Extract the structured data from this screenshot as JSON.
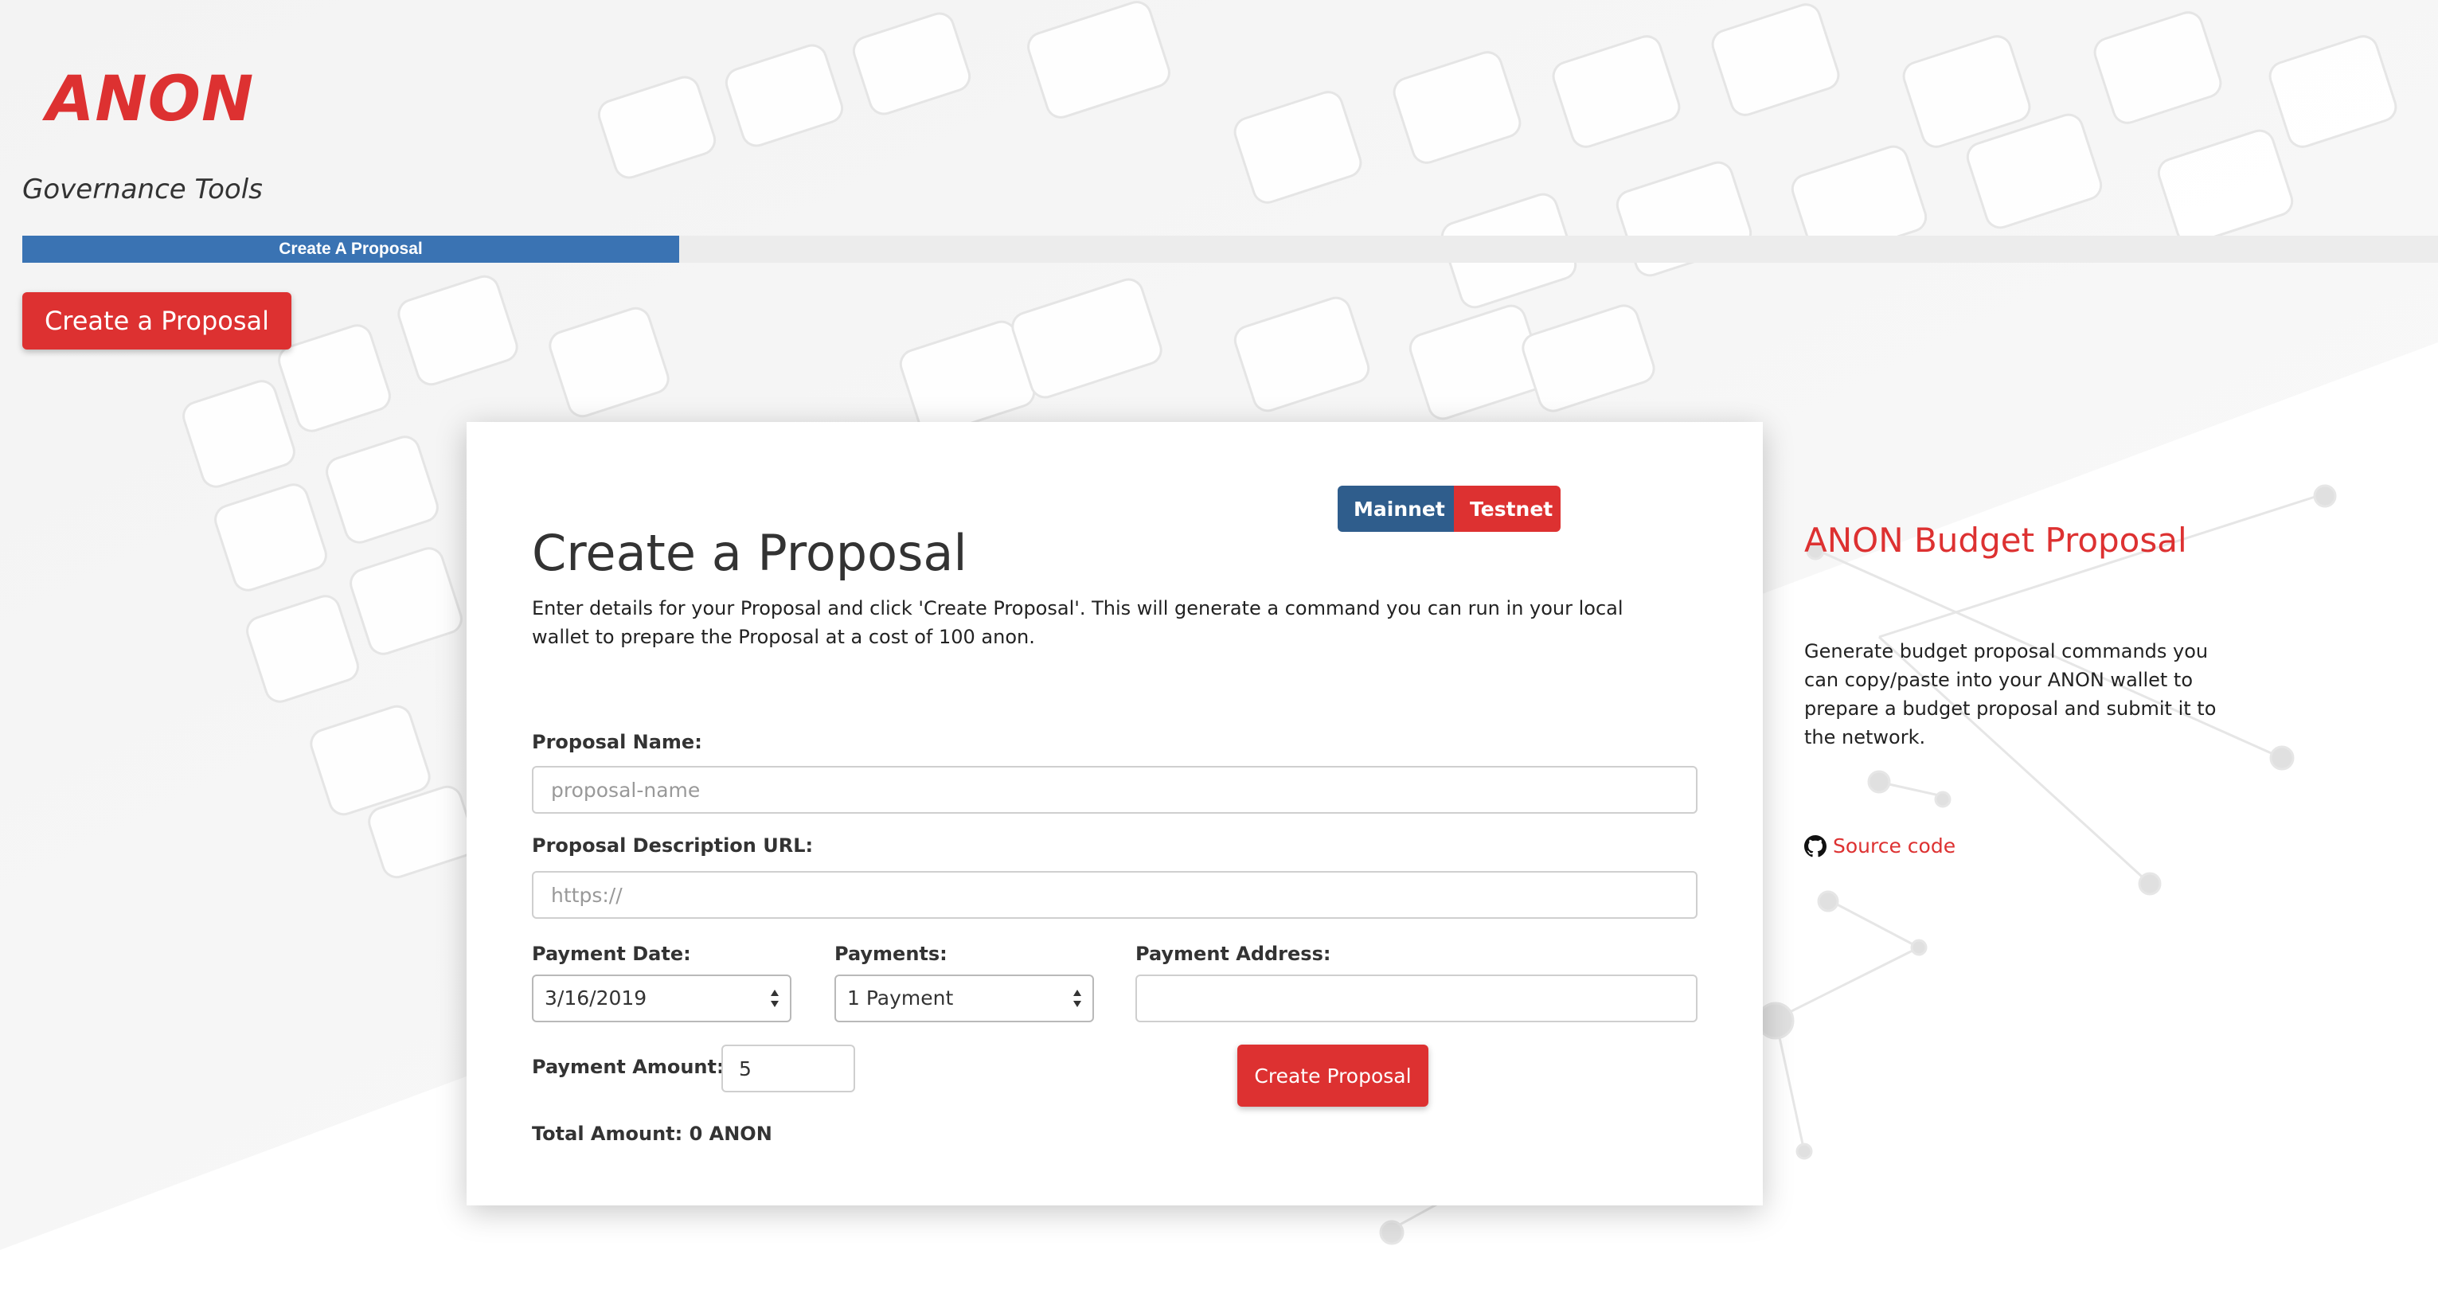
{
  "brand": {
    "logo_text": "ANON",
    "subtitle": "Governance Tools"
  },
  "progress": {
    "label": "Create A Proposal",
    "fill_fraction": 0.272
  },
  "nav": {
    "button_label": "Create a Proposal"
  },
  "network_toggle": {
    "mainnet_label": "Mainnet",
    "testnet_label": "Testnet"
  },
  "form": {
    "title": "Create a Proposal",
    "description": "Enter details for your Proposal and click 'Create Proposal'. This will generate a command you can run in your local wallet to prepare the Proposal at a cost of 100 anon.",
    "proposal_name": {
      "label": "Proposal Name:",
      "placeholder": "proposal-name",
      "value": ""
    },
    "description_url": {
      "label": "Proposal Description URL:",
      "placeholder": "https://",
      "value": ""
    },
    "payment_date": {
      "label": "Payment Date:",
      "value": "3/16/2019"
    },
    "payments": {
      "label": "Payments:",
      "value": "1 Payment"
    },
    "payment_address": {
      "label": "Payment Address:",
      "value": ""
    },
    "payment_amount": {
      "label": "Payment Amount:",
      "value": "5"
    },
    "submit_label": "Create Proposal",
    "total_label": "Total Amount: 0 ANON"
  },
  "sidebar": {
    "title": "ANON Budget Proposal",
    "text": "Generate budget proposal commands you can copy/paste into your ANON wallet to prepare a budget proposal and submit it to the network.",
    "source_link_label": "Source code",
    "source_icon": "github-icon"
  },
  "colors": {
    "accent_red": "#dd3131",
    "progress_blue": "#3a73b3",
    "mainnet_blue": "#2f5d8c"
  }
}
